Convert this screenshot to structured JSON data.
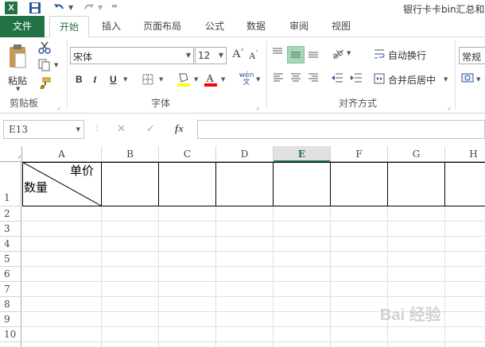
{
  "titlebar": {
    "title": "银行卡卡bin汇总和"
  },
  "tabs": [
    {
      "label": "文件",
      "kind": "file"
    },
    {
      "label": "开始",
      "kind": "active"
    },
    {
      "label": "插入",
      "kind": ""
    },
    {
      "label": "页面布局",
      "kind": ""
    },
    {
      "label": "公式",
      "kind": ""
    },
    {
      "label": "数据",
      "kind": ""
    },
    {
      "label": "审阅",
      "kind": ""
    },
    {
      "label": "视图",
      "kind": ""
    }
  ],
  "ribbon": {
    "clipboard": {
      "paste_label": "粘贴",
      "group_label": "剪贴板"
    },
    "font": {
      "font_name": "宋体",
      "font_size": "12",
      "bold": "B",
      "italic": "I",
      "underline": "U",
      "group_label": "字体",
      "font_color": "#ff0000",
      "highlight_color": "#ffff00"
    },
    "alignment": {
      "wrap_label": "自动换行",
      "merge_label": "合并后居中",
      "group_label": "对齐方式"
    },
    "number": {
      "format": "常规"
    }
  },
  "formula_bar": {
    "name_box": "E13",
    "cancel": "✕",
    "enter": "✓",
    "fx": "fx",
    "value": ""
  },
  "sheet": {
    "columns": [
      "A",
      "B",
      "C",
      "D",
      "E",
      "F",
      "G",
      "H"
    ],
    "selected_column": "E",
    "rows": [
      "1",
      "2",
      "3",
      "4",
      "5",
      "6",
      "7",
      "8",
      "9",
      "10"
    ],
    "a1_top_right": "单价",
    "a1_bottom_left": "数量"
  },
  "watermark": "Bai 经验"
}
